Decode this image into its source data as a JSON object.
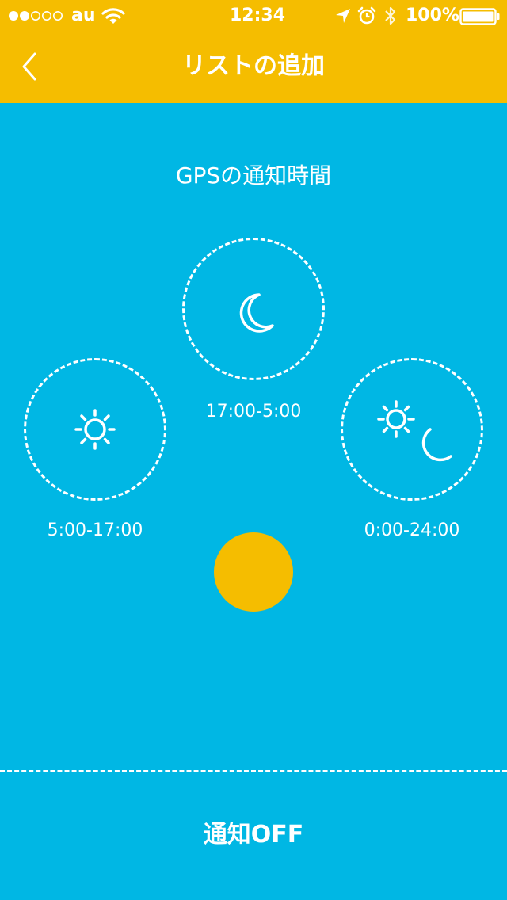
{
  "status_bar": {
    "carrier": "au",
    "time": "12:34",
    "battery": "100%",
    "signal_bars_filled": 2,
    "signal_bars_total": 5
  },
  "nav": {
    "title": "リストの追加",
    "back_icon": "chevron-left-icon"
  },
  "main": {
    "heading": "GPSの通知時間",
    "options": [
      {
        "label": "17:00-5:00",
        "icon": "moon-icon"
      },
      {
        "label": "5:00-17:00",
        "icon": "sun-icon"
      },
      {
        "label": "0:00-24:00",
        "icon": "sun-moon-icon"
      }
    ]
  },
  "footer": {
    "off_label": "通知OFF"
  },
  "colors": {
    "accent": "#F5BD00",
    "background": "#00B7E4",
    "text": "#FFFFFF"
  }
}
